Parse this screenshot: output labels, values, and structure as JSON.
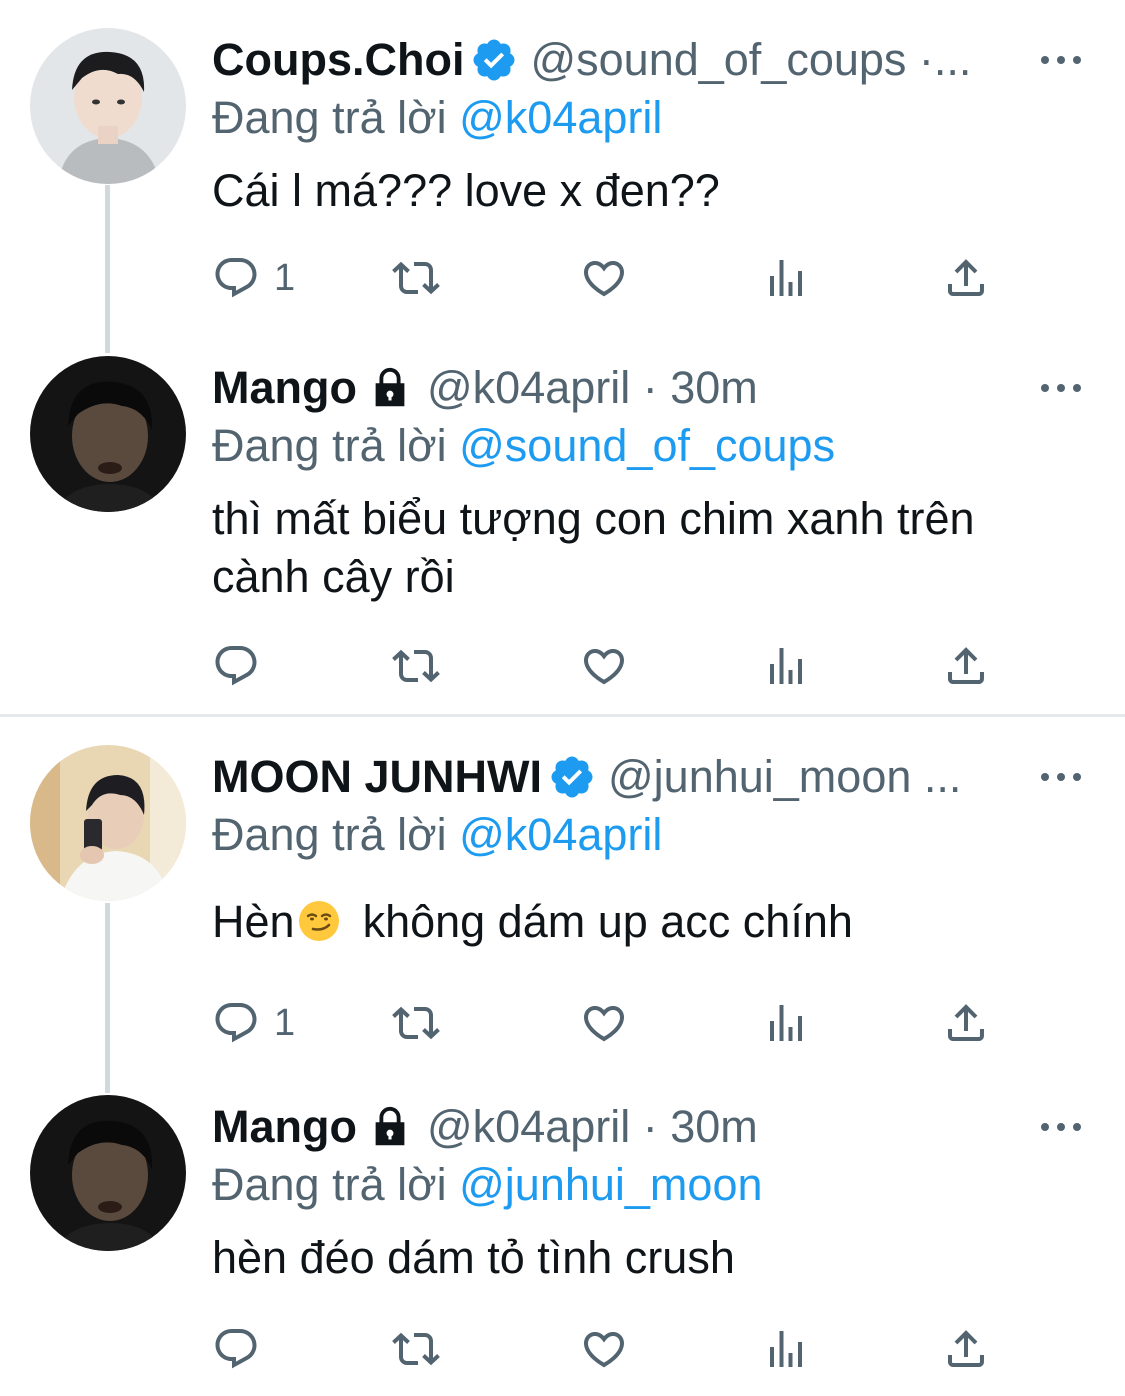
{
  "threads": [
    {
      "parent": {
        "name": "Coups.Choi",
        "verified": true,
        "handle_meta": "@sound_of_coups ·...",
        "reply_prefix": "Đang trả lời",
        "reply_to": "@k04april",
        "text": "Cái l má??? love x đen??",
        "counts": {
          "reply": "1"
        }
      },
      "reply": {
        "name": "Mango",
        "protected": true,
        "handle_meta": "@k04april · 30m",
        "reply_prefix": "Đang trả lời",
        "reply_to": "@sound_of_coups",
        "text_line1": "thì mất biểu tượng con chim xanh trên",
        "text_line2": "cành cây rồi"
      }
    },
    {
      "parent": {
        "name": "MOON JUNHWI",
        "verified": true,
        "handle_meta": "@junhui_moon ...",
        "reply_prefix": "Đang trả lời",
        "reply_to": "@k04april",
        "text_a": "Hèn",
        "emoji": "smirking-face",
        "text_b": "không dám up acc chính",
        "counts": {
          "reply": "1"
        }
      },
      "reply": {
        "name": "Mango",
        "protected": true,
        "handle_meta": "@k04april · 30m",
        "reply_prefix": "Đang trả lời",
        "reply_to": "@junhui_moon",
        "text": "hèn đéo dám tỏ tình crush"
      }
    }
  ],
  "colors": {
    "accent": "#1d9bf0",
    "muted": "#536471",
    "text": "#0f1419",
    "connector": "#cfd9de"
  }
}
